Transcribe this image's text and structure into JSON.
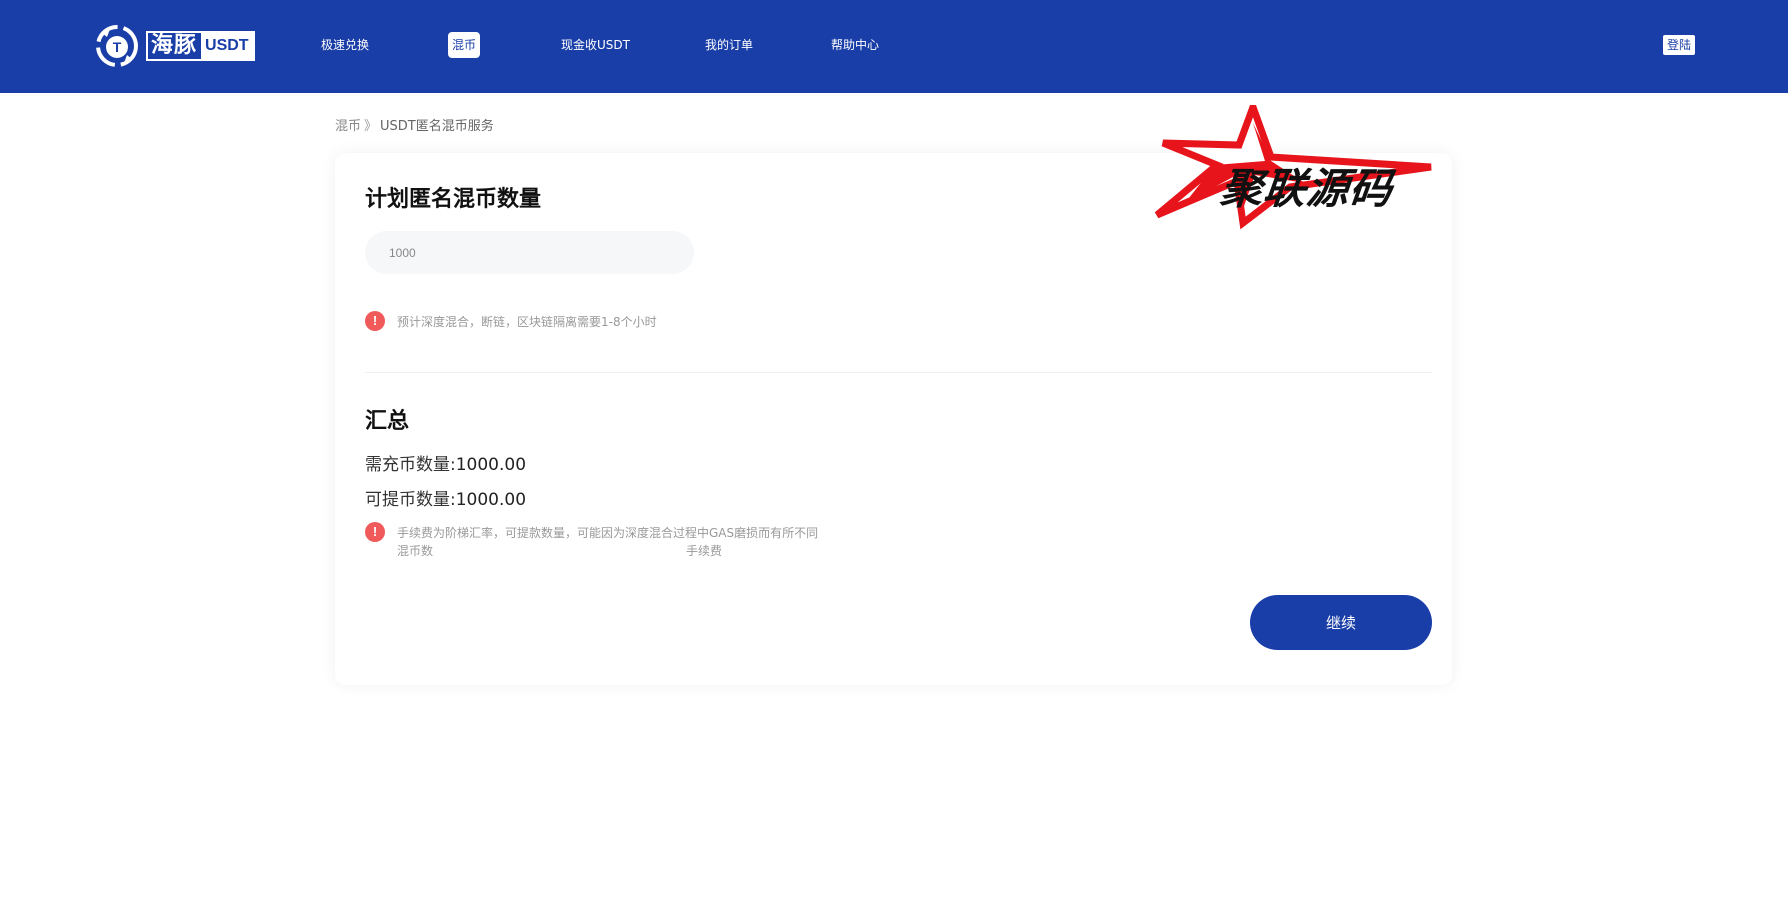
{
  "brand": {
    "name_cn": "海豚",
    "name_en": "USDT",
    "logo_letter": "T"
  },
  "nav": {
    "items": [
      {
        "label": "极速兑换"
      },
      {
        "label": "混币"
      },
      {
        "label": "现金收USDT"
      },
      {
        "label": "我的订单"
      },
      {
        "label": "帮助中心"
      }
    ],
    "active_index": 1,
    "login_label": "登陆"
  },
  "breadcrumb": {
    "parent": "混币",
    "separator": "》",
    "current": "USDT匿名混币服务"
  },
  "plan": {
    "title": "计划匿名混币数量",
    "amount_value": "1000",
    "tip": "预计深度混合，断链，区块链隔离需要1-8个小时"
  },
  "summary": {
    "title": "汇总",
    "deposit_label": "需充币数量:",
    "deposit_value": "1000.00",
    "withdraw_label": "可提币数量:",
    "withdraw_value": "1000.00",
    "fee_note_line1_a": "手续费为阶梯汇率，可提款数量，可能因为深度混合过程中GAS磨损而有所不同",
    "fee_note_line2_a": "混币数",
    "fee_note_line2_b": "手续费"
  },
  "actions": {
    "continue_label": "继续"
  },
  "watermark": {
    "text": "聚联源码"
  },
  "colors": {
    "brand_blue": "#1a3ea8",
    "alert_red": "#f05a5a",
    "watermark_red": "#e8141b"
  },
  "icons": {
    "logo": "dolphin-t-logo-icon",
    "alert": "exclamation-circle-icon",
    "watermark": "star-icon"
  }
}
